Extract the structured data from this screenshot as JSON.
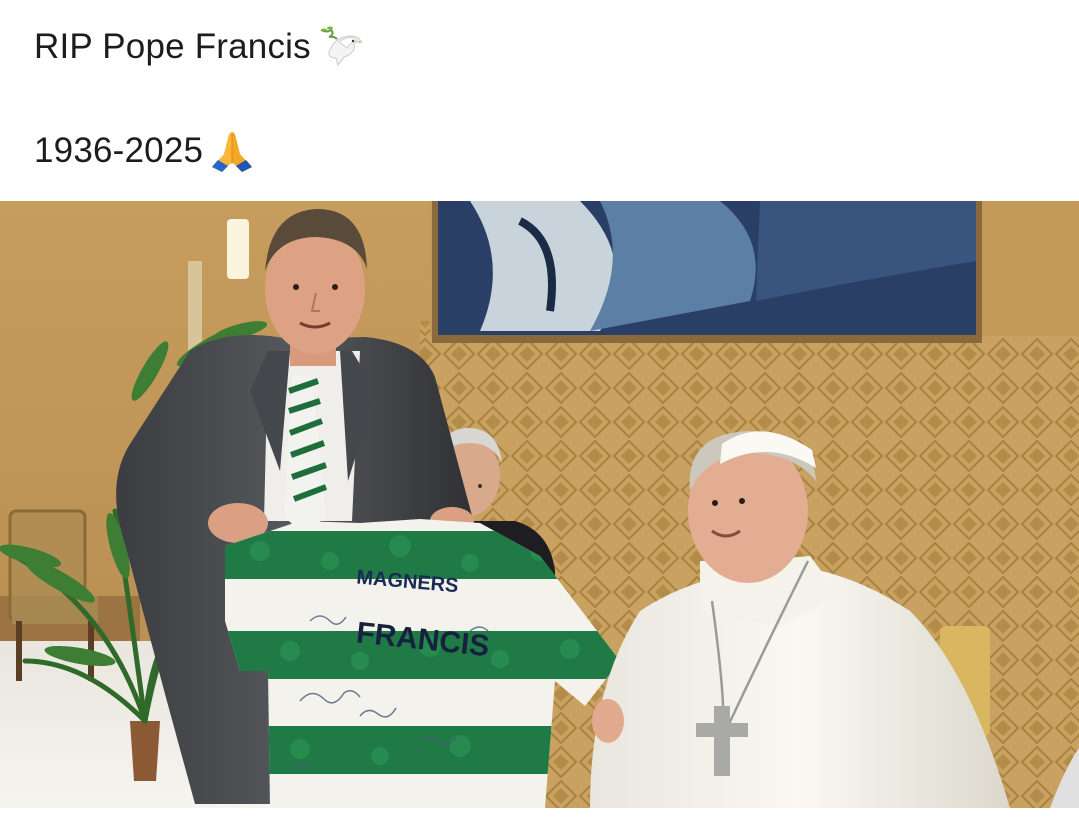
{
  "post": {
    "line1": "RIP Pope Francis",
    "line1_emoji": "dove-icon",
    "line2": "1936-2025",
    "line2_emoji": "folded-hands-icon"
  },
  "photo": {
    "subject": "photo",
    "shirt_sponsor": "MAGNERS",
    "shirt_name": "FRANCIS"
  },
  "colors": {
    "text": "#1c1c1c",
    "wall": "#c69d5f",
    "hoop_green": "#1f7a45",
    "white": "#f4f2ec"
  }
}
